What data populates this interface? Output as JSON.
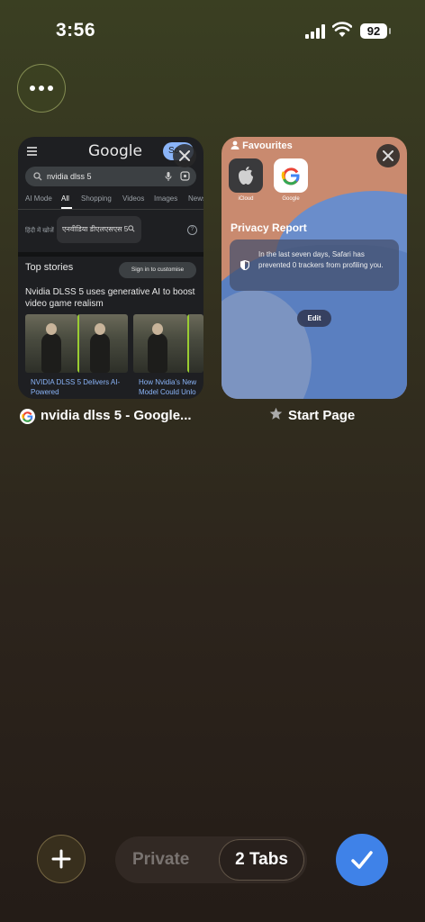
{
  "status": {
    "time": "3:56",
    "battery": "92"
  },
  "tabs": [
    {
      "title": "nvidia dlss 5 - Google...",
      "favicon": "G",
      "content": {
        "logo": "Google",
        "toggle_label": "Sc",
        "query": "nvidia dlss 5",
        "nav": [
          "AI Mode",
          "All",
          "Shopping",
          "Videos",
          "Images",
          "News"
        ],
        "hindi_label": "हिंदी में खोजें",
        "hindi_query": "एनवीडिया डीएलएसएस 5",
        "help": "?",
        "top_stories": "Top stories",
        "signin": "Sign in to customise",
        "headline": "Nvidia DLSS 5 uses generative AI to boost video game realism",
        "caption1": "NVIDIA DLSS 5 Delivers AI-Powered",
        "caption2": "How Nvidia's New Model Could Unlo"
      }
    },
    {
      "title": "Start Page",
      "content": {
        "favourites_label": "Favourites",
        "favourites": [
          "iCloud",
          "Google"
        ],
        "privacy_title": "Privacy Report",
        "privacy_text": "In the last seven days, Safari has prevented 0 trackers from profiling you.",
        "edit_label": "Edit"
      }
    }
  ],
  "bottom": {
    "private_label": "Private",
    "tabs_label": "2 Tabs"
  },
  "colors": {
    "accent": "#3f82e8",
    "link": "#8ab4f8"
  }
}
